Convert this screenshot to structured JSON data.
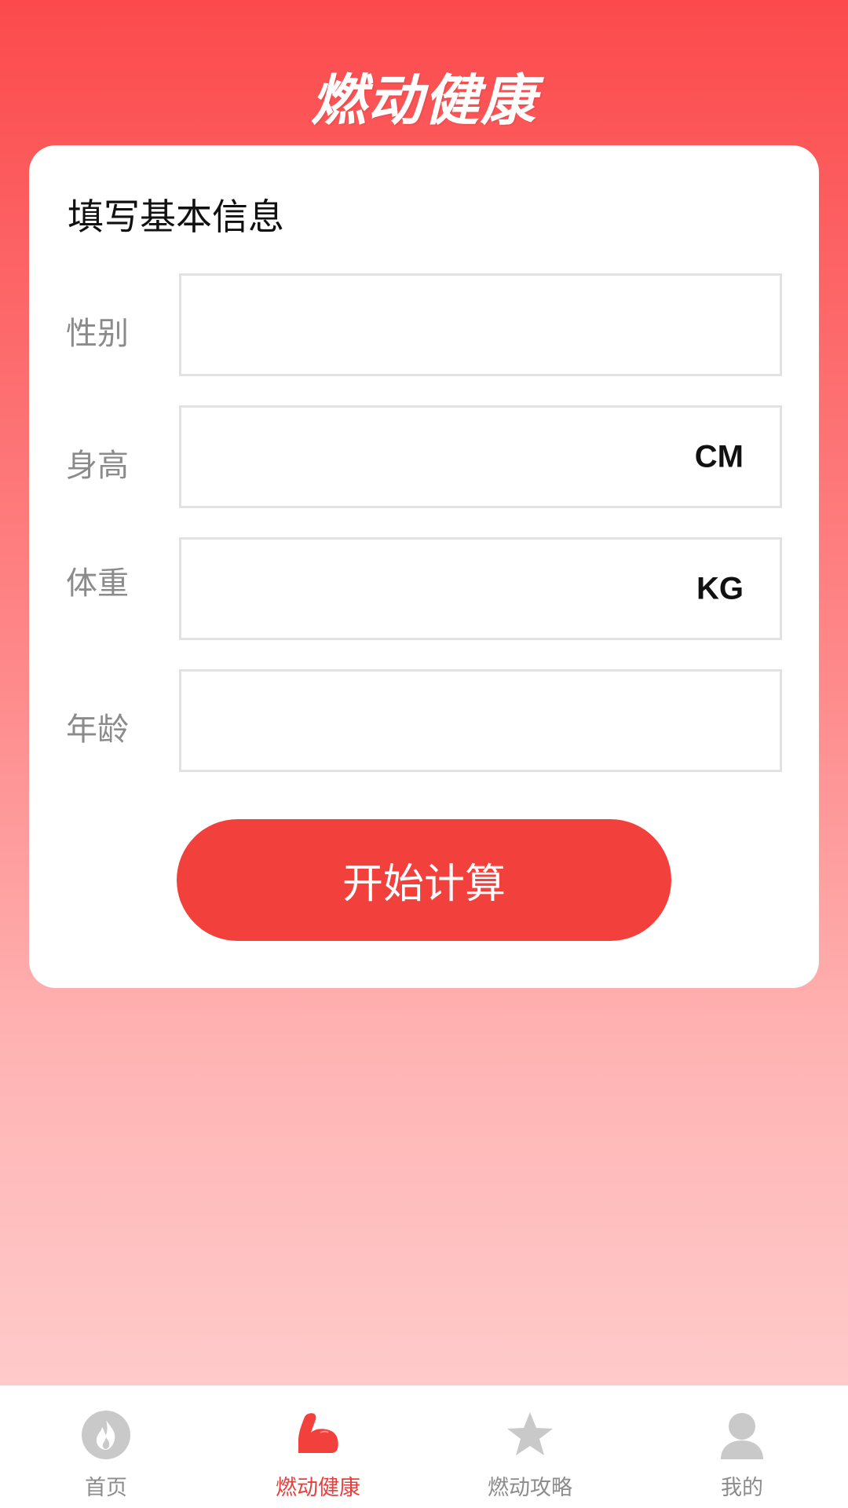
{
  "app_title": "燃动健康",
  "form": {
    "title": "填写基本信息",
    "fields": [
      {
        "label": "性别",
        "value": "",
        "unit": ""
      },
      {
        "label": "身高",
        "value": "",
        "unit": "CM"
      },
      {
        "label": "体重",
        "value": "",
        "unit": "KG"
      },
      {
        "label": "年龄",
        "value": "",
        "unit": ""
      }
    ],
    "submit_label": "开始计算"
  },
  "tabs": [
    {
      "label": "首页",
      "icon": "flame-circle-icon",
      "active": false
    },
    {
      "label": "燃动健康",
      "icon": "muscle-arm-icon",
      "active": true
    },
    {
      "label": "燃动攻略",
      "icon": "star-icon",
      "active": false
    },
    {
      "label": "我的",
      "icon": "user-icon",
      "active": false
    }
  ],
  "colors": {
    "accent": "#f2403d",
    "tab_inactive": "#8c8c8c",
    "tab_active": "#e6403e"
  }
}
